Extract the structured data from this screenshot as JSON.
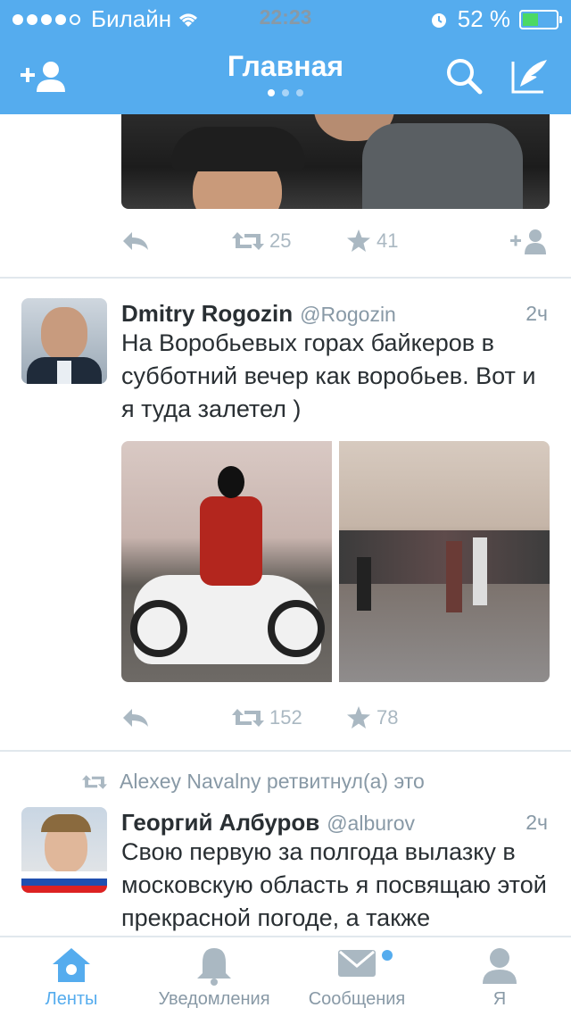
{
  "status_bar": {
    "carrier": "Билайн",
    "time": "22:23",
    "battery_percent": "52 %",
    "battery_level": 0.52
  },
  "nav": {
    "title": "Главная",
    "page_count": 3,
    "active_page": 1
  },
  "tweets": [
    {
      "retweets": "25",
      "favorites": "41"
    },
    {
      "name": "Dmitry Rogozin",
      "handle": "@Rogozin",
      "time": "2ч",
      "text": "На Воробьевых горах байкеров в субботний вечер как воробьев. Вот и я туда залетел )",
      "retweets": "152",
      "favorites": "78"
    },
    {
      "retweet_note": "Alexey Navalny ретвитнул(а) это",
      "name": "Георгий Албуров",
      "handle": "@alburov",
      "time": "2ч",
      "text": "Свою первую за полгода вылазку в московскую область я посвящаю этой прекрасной погоде, а также"
    }
  ],
  "tabs": [
    {
      "label": "Ленты",
      "icon": "home-icon",
      "active": true
    },
    {
      "label": "Уведомления",
      "icon": "bell-icon",
      "active": false
    },
    {
      "label": "Сообщения",
      "icon": "envelope-icon",
      "active": false,
      "badge": true
    },
    {
      "label": "Я",
      "icon": "person-icon",
      "active": false
    }
  ],
  "colors": {
    "brand_blue": "#55acee",
    "text": "#292f33",
    "muted": "#8899a6",
    "action_gray": "#aab8c2"
  }
}
